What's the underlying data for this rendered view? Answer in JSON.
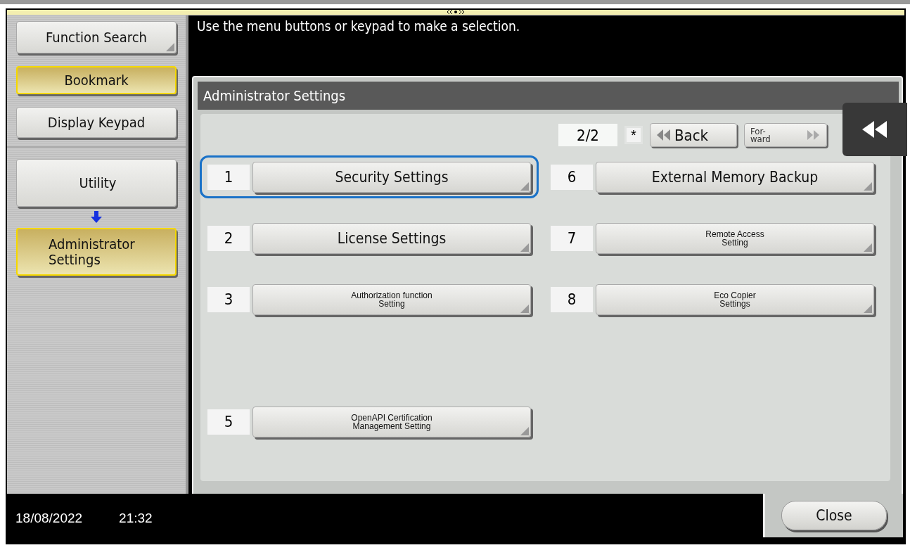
{
  "sidebar": {
    "top_buttons": [
      {
        "label": "Function Search",
        "selected": false
      },
      {
        "label": "Bookmark",
        "selected": true
      },
      {
        "label": "Display Keypad",
        "selected": false
      }
    ],
    "path": [
      {
        "label": "Utility",
        "selected": false
      },
      {
        "label": "Administrator Settings",
        "selected": true
      }
    ]
  },
  "message": "Use the menu buttons or keypad to make a selection.",
  "panel": {
    "title": "Administrator Settings",
    "page": "2/2",
    "star_key": "*",
    "back_button": "Back",
    "forward_button": {
      "lines": [
        "For-",
        "ward"
      ],
      "disabled": true
    },
    "items": [
      {
        "kind": "item",
        "number": "1",
        "lines": [
          "Security Settings"
        ],
        "compact": false,
        "selected": true
      },
      {
        "kind": "item",
        "number": "2",
        "lines": [
          "License Settings"
        ],
        "compact": false,
        "selected": false
      },
      {
        "kind": "item",
        "number": "3",
        "lines": [
          "Authorization function",
          "Setting"
        ],
        "compact": true,
        "selected": false
      },
      {
        "kind": "spacer"
      },
      {
        "kind": "item",
        "number": "5",
        "lines": [
          "OpenAPI Certification",
          "Management Setting"
        ],
        "compact": true,
        "selected": false
      },
      {
        "kind": "item",
        "number": "6",
        "lines": [
          "External Memory Backup"
        ],
        "compact": false,
        "selected": false
      },
      {
        "kind": "item",
        "number": "7",
        "lines": [
          "Remote Access",
          "Setting"
        ],
        "compact": true,
        "selected": false
      },
      {
        "kind": "item",
        "number": "8",
        "lines": [
          "Eco Copier",
          "Settings"
        ],
        "compact": true,
        "selected": false
      }
    ]
  },
  "status_bar": {
    "date": "18/08/2022",
    "time": "21:32",
    "close_button": "Close"
  }
}
